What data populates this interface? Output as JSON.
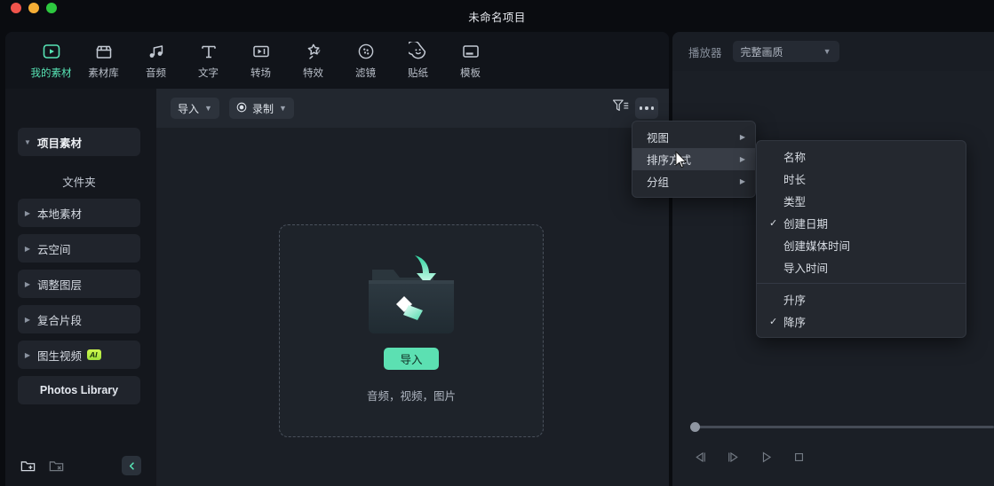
{
  "window": {
    "title": "未命名项目",
    "traffic_lights": [
      "close-red",
      "minimize-yellow",
      "maximize-green"
    ]
  },
  "colors": {
    "accent": "#5ce0b2",
    "accent_text": "#57e3b4",
    "panel_bg": "#14171d",
    "main_bg": "#1b1f26",
    "toolbar_bg": "#22272f",
    "menu_bg": "#24282f",
    "menu_highlight": "#383d46",
    "ai_badge": "#cff84f",
    "traffic_red": "#f0544c",
    "traffic_yellow": "#f5ae36",
    "traffic_green": "#2dc93f"
  },
  "navbar": {
    "items": [
      {
        "label": "我的素材",
        "icon": "my-media-icon",
        "active": true
      },
      {
        "label": "素材库",
        "icon": "stock-library-icon",
        "active": false
      },
      {
        "label": "音频",
        "icon": "audio-icon",
        "active": false
      },
      {
        "label": "文字",
        "icon": "text-icon",
        "active": false
      },
      {
        "label": "转场",
        "icon": "transition-icon",
        "active": false
      },
      {
        "label": "特效",
        "icon": "effects-icon",
        "active": false
      },
      {
        "label": "滤镜",
        "icon": "filter-icon",
        "active": false
      },
      {
        "label": "贴纸",
        "icon": "sticker-icon",
        "active": false
      },
      {
        "label": "模板",
        "icon": "template-icon",
        "active": false
      }
    ]
  },
  "sidebar": {
    "root": {
      "label": "项目素材",
      "caret": "caret-down-icon"
    },
    "folder_header": "文件夹",
    "items": [
      {
        "label": "本地素材",
        "caret": "caret-right-icon",
        "badge": null
      },
      {
        "label": "云空间",
        "caret": "caret-right-icon",
        "badge": null
      },
      {
        "label": "调整图层",
        "caret": "caret-right-icon",
        "badge": null
      },
      {
        "label": "复合片段",
        "caret": "caret-right-icon",
        "badge": null
      },
      {
        "label": "图生视频",
        "caret": "caret-right-icon",
        "badge": "AI"
      }
    ],
    "photos_library": "Photos Library",
    "bottom": {
      "new_folder_icon": "new-folder-icon",
      "delete_folder_icon": "delete-folder-icon",
      "collapse_icon": "chevron-left-icon"
    }
  },
  "toolbar": {
    "import_label": "导入",
    "import_chevron": "chevron-down-icon",
    "record_label": "录制",
    "record_icon": "record-dot-icon",
    "record_chevron": "chevron-down-icon",
    "filter_sort_icon": "filter-sort-icon",
    "more_icon": "more-dots-icon"
  },
  "dropzone": {
    "art_icon": "folder-import-arrow-icon",
    "button_label": "导入",
    "caption": "音频，视频，图片"
  },
  "context_menu": {
    "items": [
      {
        "label": "视图",
        "arrow": "caret-right-icon",
        "highlighted": false
      },
      {
        "label": "排序方式",
        "arrow": "caret-right-icon",
        "highlighted": true
      },
      {
        "label": "分组",
        "arrow": "caret-right-icon",
        "highlighted": false
      }
    ]
  },
  "sort_submenu": {
    "group_fields": [
      {
        "label": "名称",
        "checked": false
      },
      {
        "label": "时长",
        "checked": false
      },
      {
        "label": "类型",
        "checked": false
      },
      {
        "label": "创建日期",
        "checked": true
      },
      {
        "label": "创建媒体时间",
        "checked": false
      },
      {
        "label": "导入时间",
        "checked": false
      }
    ],
    "group_direction": [
      {
        "label": "升序",
        "checked": false
      },
      {
        "label": "降序",
        "checked": true
      }
    ],
    "check_icon": "check-icon"
  },
  "player": {
    "label": "播放器",
    "quality_value": "完整画质",
    "quality_chevron": "chevron-down-icon",
    "scrub_position_pct": 0,
    "controls": [
      {
        "name": "prev-frame-button",
        "icon": "step-backward-icon"
      },
      {
        "name": "next-frame-button",
        "icon": "step-forward-icon"
      },
      {
        "name": "play-button",
        "icon": "play-icon"
      },
      {
        "name": "stop-button",
        "icon": "stop-icon"
      }
    ]
  },
  "cursor": {
    "icon": "arrow-cursor-icon"
  }
}
